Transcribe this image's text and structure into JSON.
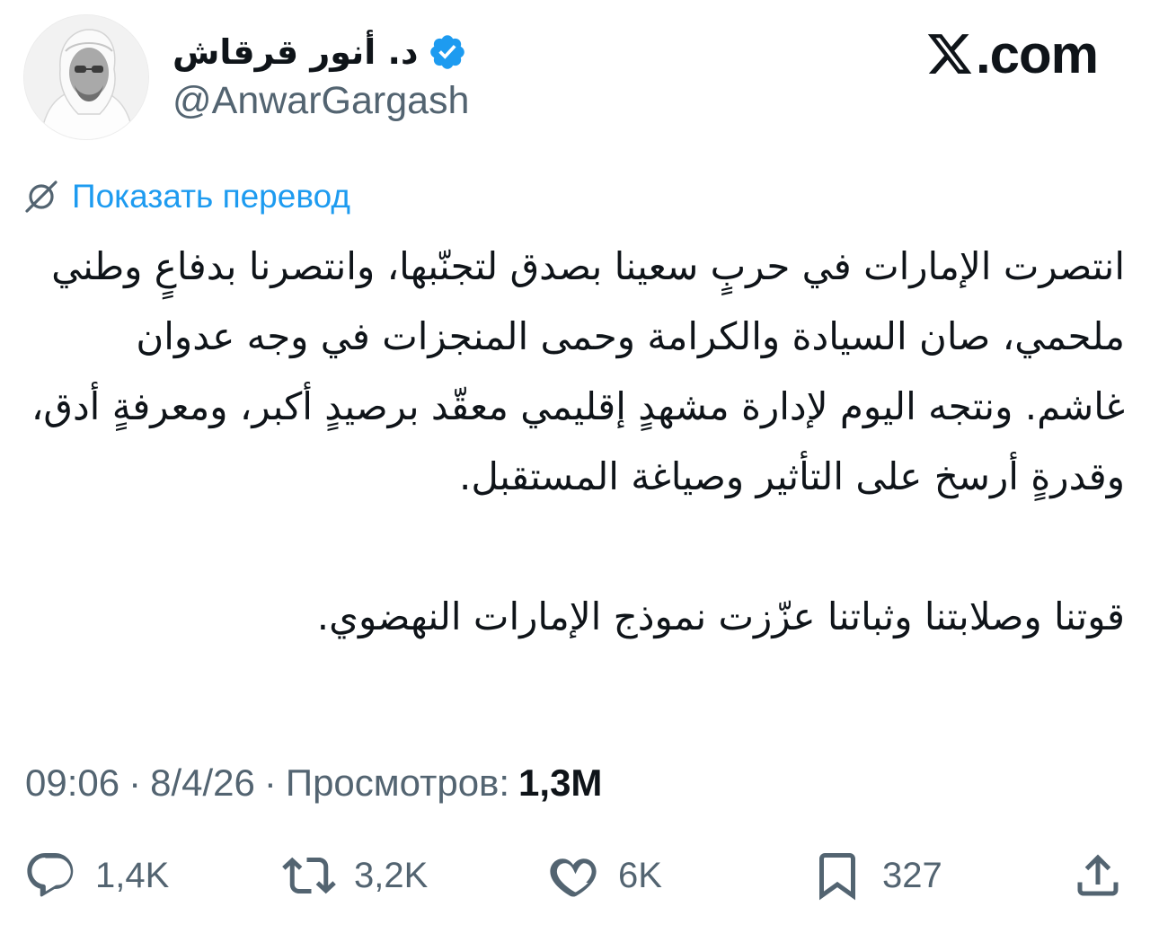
{
  "header": {
    "display_name": "د. أنور قرقاش",
    "handle": "@AnwarGargash",
    "site_name": ".com"
  },
  "translate": {
    "label": "Показать перевод"
  },
  "tweet": {
    "paragraph1": "انتصرت الإمارات في حربٍ سعينا بصدق لتجنّبها، وانتصرنا بدفاعٍ وطني ملحمي، صان السيادة والكرامة وحمى المنجزات في وجه عدوان غاشم. ونتجه اليوم لإدارة مشهدٍ إقليمي معقّد برصيدٍ أكبر، ومعرفةٍ أدق، وقدرةٍ أرسخ على التأثير وصياغة المستقبل.",
    "paragraph2": "قوتنا وصلابتنا وثباتنا عزّزت نموذج الإمارات النهضوي."
  },
  "meta": {
    "time": "09:06",
    "date": "8/4/26",
    "separator": "·",
    "views_label": "Просмотров:",
    "views_count": "1,3M"
  },
  "actions": {
    "replies": "1,4K",
    "reposts": "3,2K",
    "likes": "6K",
    "bookmarks": "327"
  },
  "colors": {
    "accent": "#1d9bf0",
    "secondary_text": "#536471",
    "primary_text": "#0f1419"
  }
}
